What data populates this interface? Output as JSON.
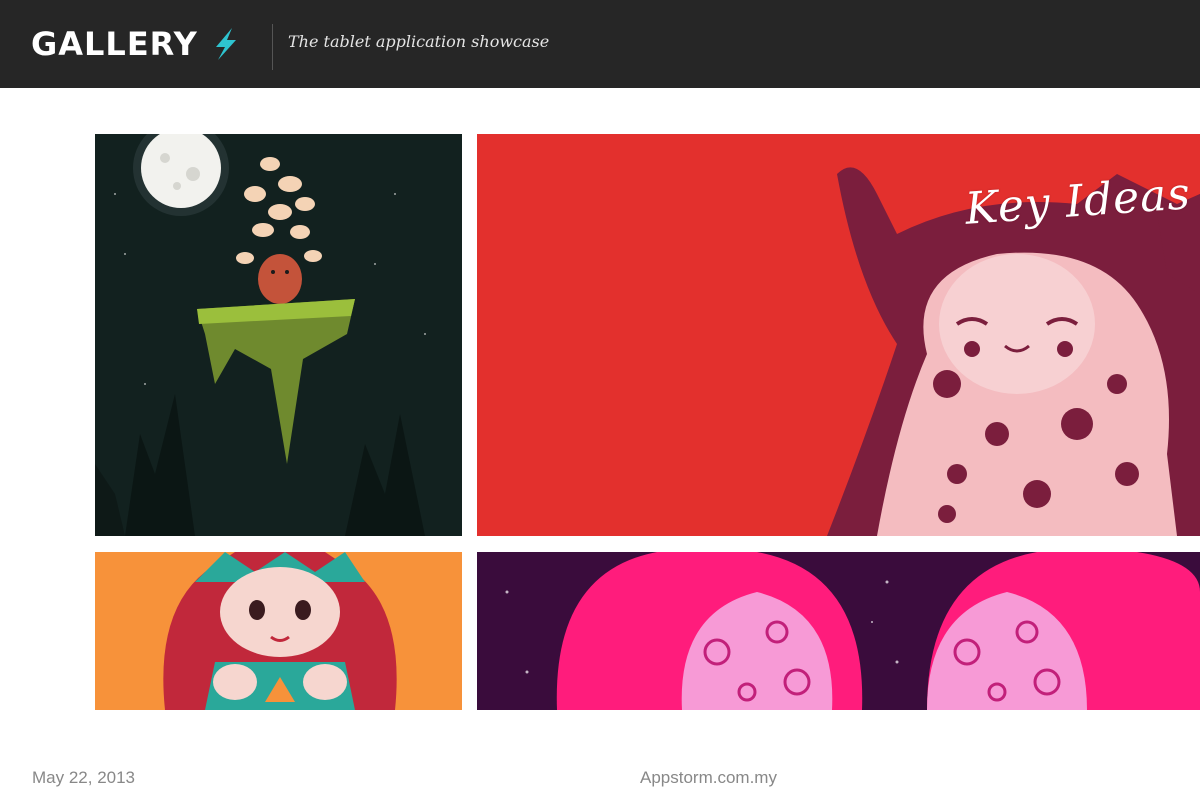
{
  "header": {
    "logo_text": "GALLERY",
    "tagline": "The tablet application showcase",
    "bolt_icon": "lightning-bolt-icon",
    "bolt_color": "#2ec4d0"
  },
  "gallery": {
    "featured_title": "Key Ideas"
  },
  "footer": {
    "date": "May 22, 2013",
    "source": "Appstorm.com.my"
  },
  "colors": {
    "header_bg": "#262626",
    "tile_red": "#e3302d",
    "tile_orange": "#f7923a",
    "tile_purple": "#3a0c3c",
    "tile_pink": "#ff1c7c",
    "tile_night": "#12211f"
  }
}
